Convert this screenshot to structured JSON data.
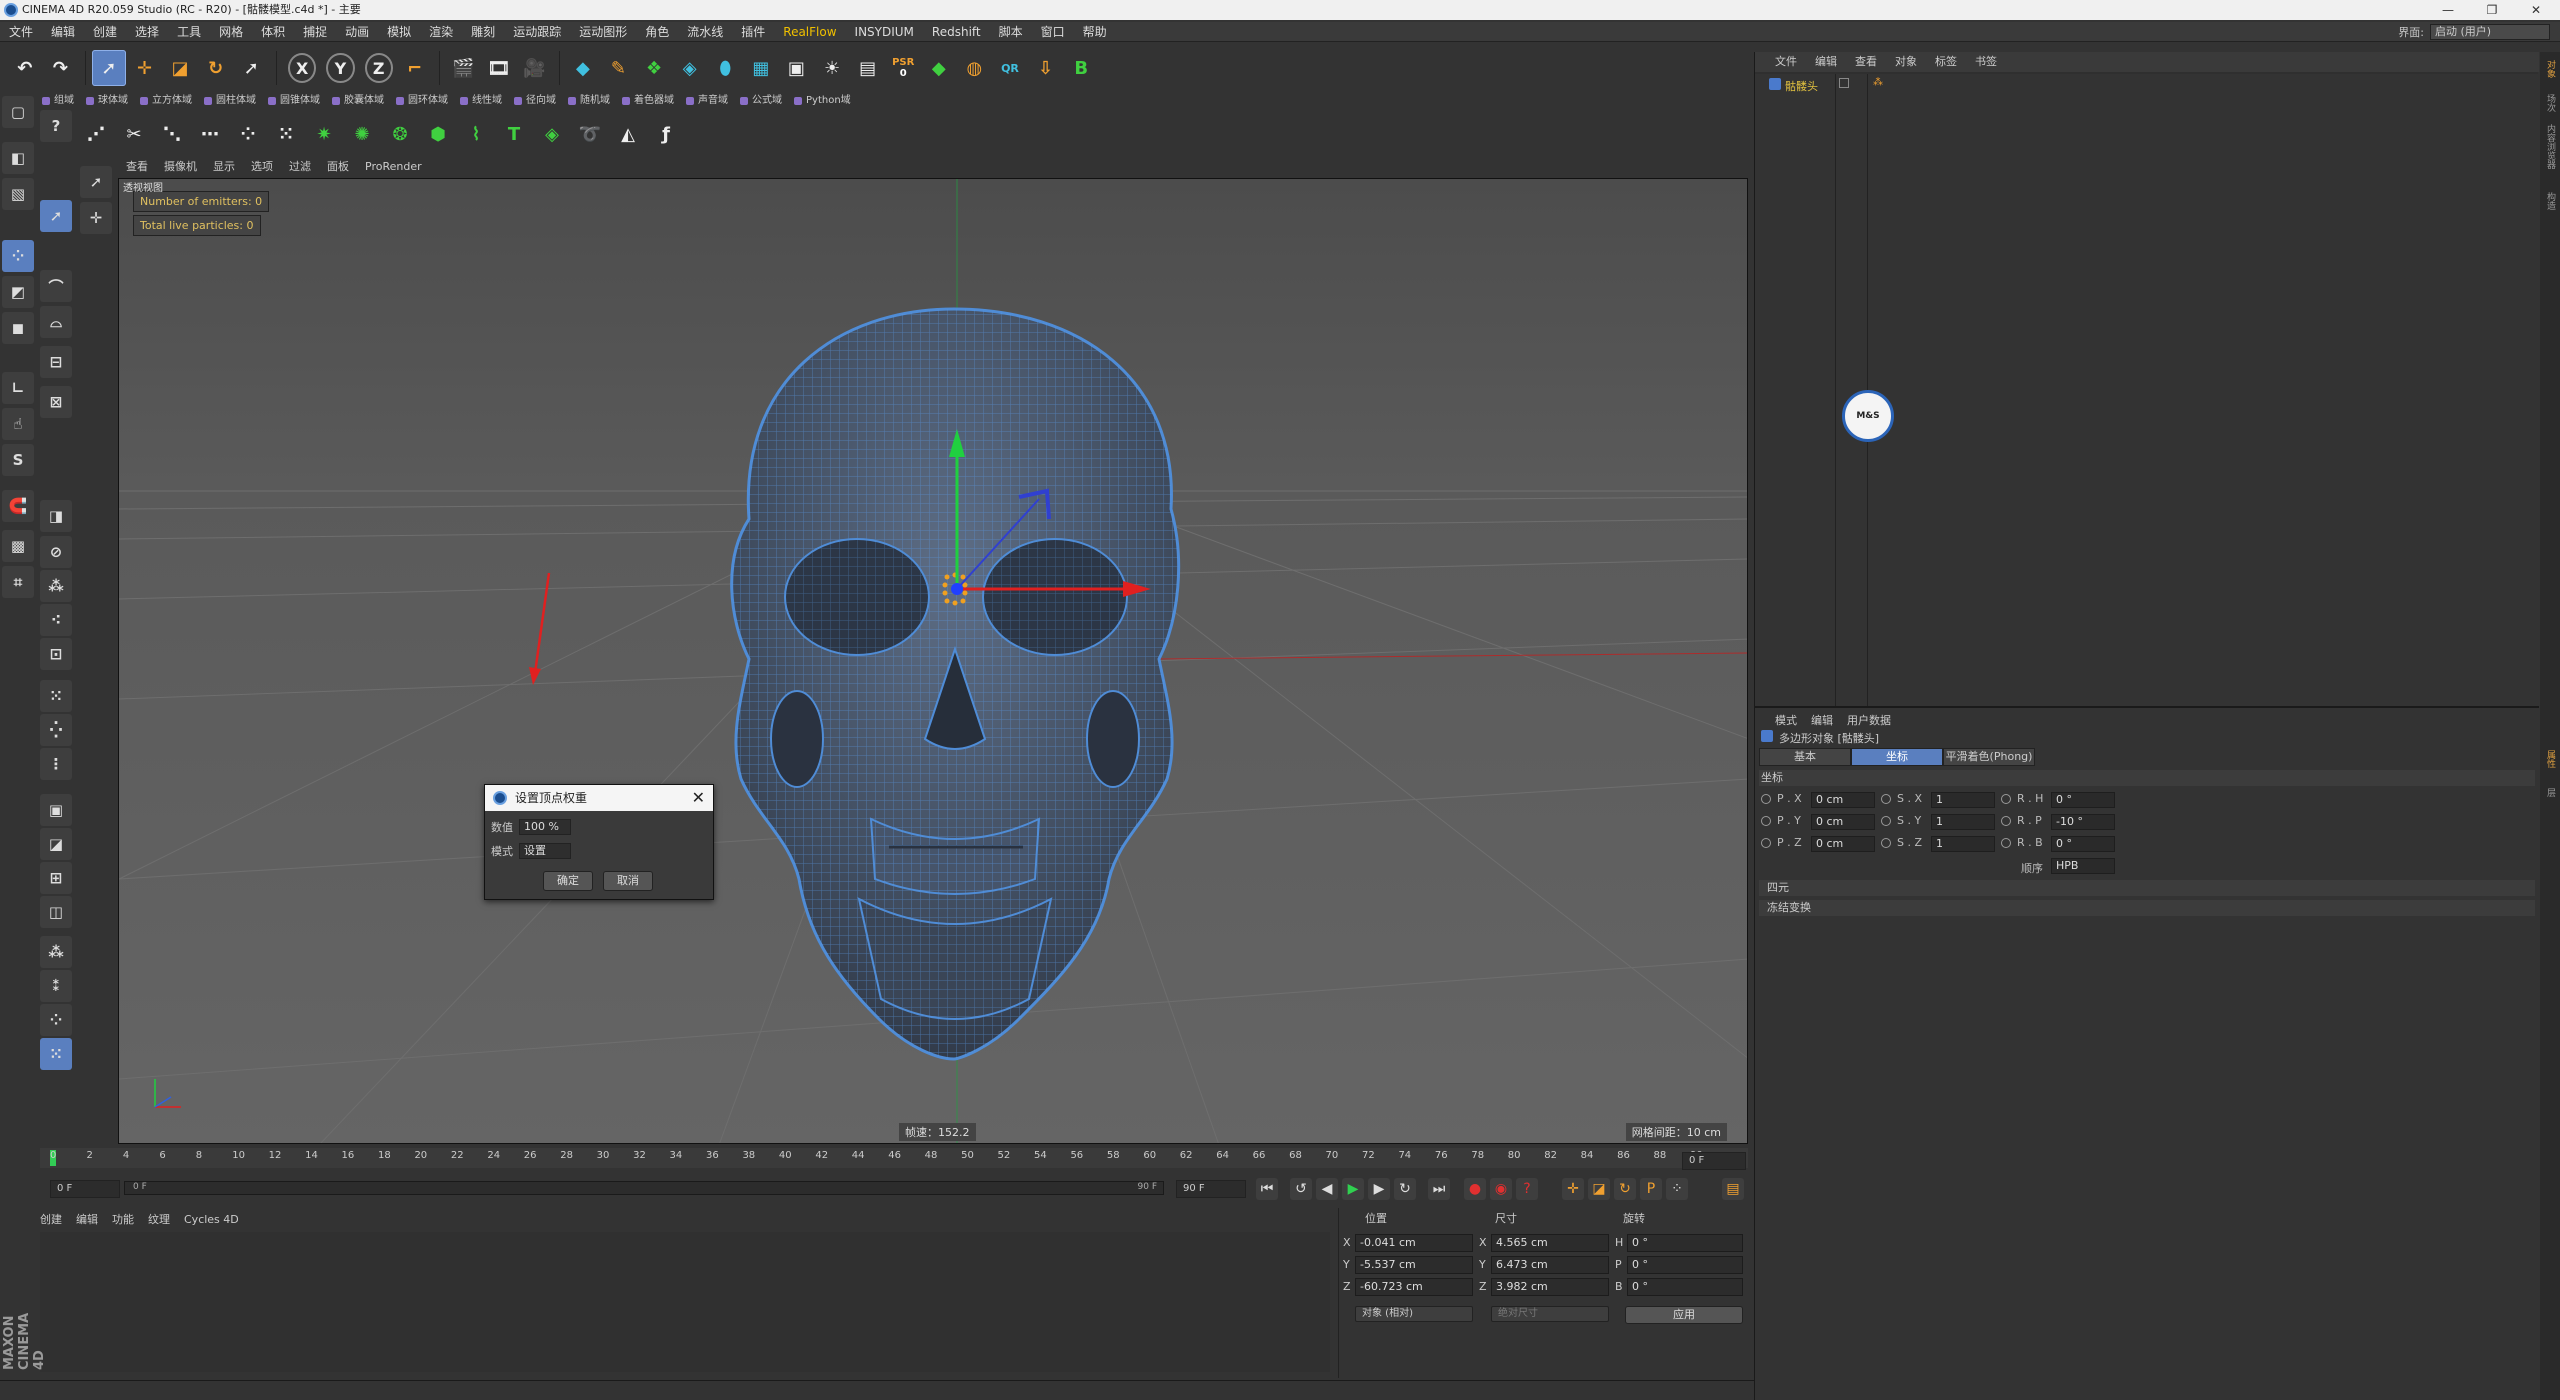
{
  "window": {
    "title": "CINEMA 4D R20.059 Studio (RC - R20) - [骷髅模型.c4d *] - 主要",
    "minimize": "—",
    "restore": "❐",
    "close": "✕"
  },
  "menu": {
    "items": [
      "文件",
      "编辑",
      "创建",
      "选择",
      "工具",
      "网格",
      "体积",
      "捕捉",
      "动画",
      "模拟",
      "渲染",
      "雕刻",
      "运动跟踪",
      "运动图形",
      "角色",
      "流水线",
      "插件",
      "RealFlow",
      "INSYDIUM",
      "Redshift",
      "脚本",
      "窗口",
      "帮助"
    ],
    "layout_label": "界面:",
    "layout_value": "启动 (用户)"
  },
  "toolbar2": {
    "items": [
      "组域",
      "球体域",
      "立方体域",
      "圆柱体域",
      "圆锥体域",
      "胶囊体域",
      "圆环体域",
      "线性域",
      "径向域",
      "随机域",
      "着色器域",
      "声音域",
      "公式域",
      "Python域"
    ]
  },
  "toolbar1": {
    "axis_x": "X",
    "axis_y": "Y",
    "axis_z": "Z",
    "psr_top": "PSR",
    "psr_bottom": "0",
    "qr": "QR"
  },
  "toolbar3": {
    "text_tool": "T"
  },
  "viewport": {
    "menu": [
      "查看",
      "摄像机",
      "显示",
      "选项",
      "过滤",
      "面板",
      "ProRender"
    ],
    "camera_label": "透视视图",
    "emitters": "Number of emitters: 0",
    "particles": "Total live particles: 0",
    "speed": "帧速：152.2",
    "grid_spacing": "网格间距：10 cm",
    "colors": {
      "mesh": "#4f8cd6",
      "x_axis": "#e02020",
      "y_axis": "#20d040"
    }
  },
  "dialog": {
    "title": "设置顶点权重",
    "value_label": "数值",
    "value": "100 %",
    "mode_label": "模式",
    "mode_value": "设置",
    "ok": "确定",
    "cancel": "取消"
  },
  "timeline": {
    "ticks": [
      "0",
      "2",
      "4",
      "6",
      "8",
      "10",
      "12",
      "14",
      "16",
      "18",
      "20",
      "22",
      "24",
      "26",
      "28",
      "30",
      "32",
      "34",
      "36",
      "38",
      "40",
      "42",
      "44",
      "46",
      "48",
      "50",
      "52",
      "54",
      "56",
      "58",
      "60",
      "62",
      "64",
      "66",
      "68",
      "70",
      "72",
      "74",
      "76",
      "78",
      "80",
      "82",
      "84",
      "86",
      "88",
      "90"
    ],
    "current_frame": "0 F",
    "start_frame": "0 F",
    "bar_start": "0 F",
    "bar_end": "90 F",
    "end_frame": "90 F"
  },
  "material_manager": {
    "menu": [
      "创建",
      "编辑",
      "功能",
      "纹理",
      "Cycles 4D"
    ]
  },
  "brand": {
    "logo": "MAXON CINEMA 4D"
  },
  "coordinates": {
    "headers": {
      "position": "位置",
      "size": "尺寸",
      "rotation": "旋转"
    },
    "rows": [
      {
        "axis": "X",
        "pos": "-0.041 cm",
        "size_axis": "X",
        "size": "4.565 cm",
        "rot_axis": "H",
        "rot": "0 °"
      },
      {
        "axis": "Y",
        "pos": "-5.537 cm",
        "size_axis": "Y",
        "size": "6.473 cm",
        "rot_axis": "P",
        "rot": "0 °"
      },
      {
        "axis": "Z",
        "pos": "-60.723 cm",
        "size_axis": "Z",
        "size": "3.982 cm",
        "rot_axis": "B",
        "rot": "0 °"
      }
    ],
    "object_mode": "对象 (相对)",
    "size_mode": "绝对尺寸",
    "apply": "应用"
  },
  "object_manager": {
    "menu": [
      "文件",
      "编辑",
      "查看",
      "对象",
      "标签",
      "书签"
    ],
    "object_name": "骷髅头",
    "logo_text": "M&S"
  },
  "attributes": {
    "menu": [
      "模式",
      "编辑",
      "用户数据"
    ],
    "title": "多边形对象 [骷髅头]",
    "tabs": [
      "基本",
      "坐标",
      "平滑着色(Phong)"
    ],
    "section": "坐标",
    "rows": [
      {
        "p_label": "P . X",
        "p": "0 cm",
        "s_label": "S . X",
        "s": "1",
        "r_label": "R . H",
        "r": "0 °"
      },
      {
        "p_label": "P . Y",
        "p": "0 cm",
        "s_label": "S . Y",
        "s": "1",
        "r_label": "R . P",
        "r": "-10 °"
      },
      {
        "p_label": "P . Z",
        "p": "0 cm",
        "s_label": "S . Z",
        "s": "1",
        "r_label": "R . B",
        "r": "0 °"
      }
    ],
    "order_label": "顺序",
    "order_value": "HPB",
    "quaternion": "四元",
    "freeze": "冻结变换"
  },
  "side_tabs": [
    "对象",
    "场次",
    "内容浏览器",
    "构造",
    "属性",
    "层"
  ]
}
